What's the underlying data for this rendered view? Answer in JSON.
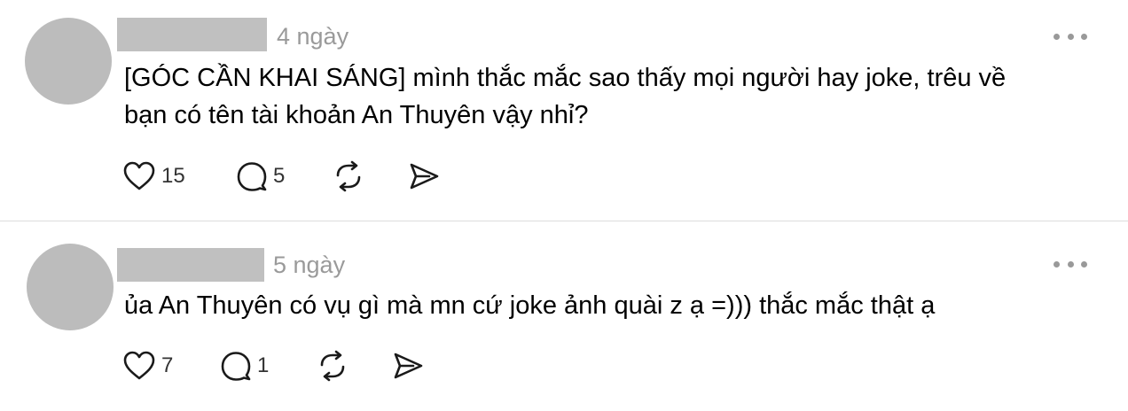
{
  "posts": [
    {
      "timestamp": "4 ngày",
      "text_lines": [
        "[GÓC CẦN KHAI SÁNG] mình thắc mắc sao thấy mọi người hay joke, trêu về",
        "bạn có tên tài khoản An Thuyên vậy nhỉ?"
      ],
      "likes": "15",
      "replies": "5"
    },
    {
      "timestamp": "5 ngày",
      "text_lines": [
        "ủa An Thuyên có vụ gì mà mn cứ joke ảnh quài z ạ =))) thắc mắc thật ạ"
      ],
      "likes": "7",
      "replies": "1"
    }
  ],
  "icons": {
    "like": "heart-icon",
    "reply": "comment-icon",
    "repost": "repost-icon",
    "share": "send-icon",
    "more": "more-horizontal-icon"
  },
  "colors": {
    "text": "#000000",
    "muted": "#9a9a9a",
    "icon": "#1a1a1a",
    "avatar_placeholder": "#bcbcbc",
    "divider": "#dcdcdc"
  }
}
